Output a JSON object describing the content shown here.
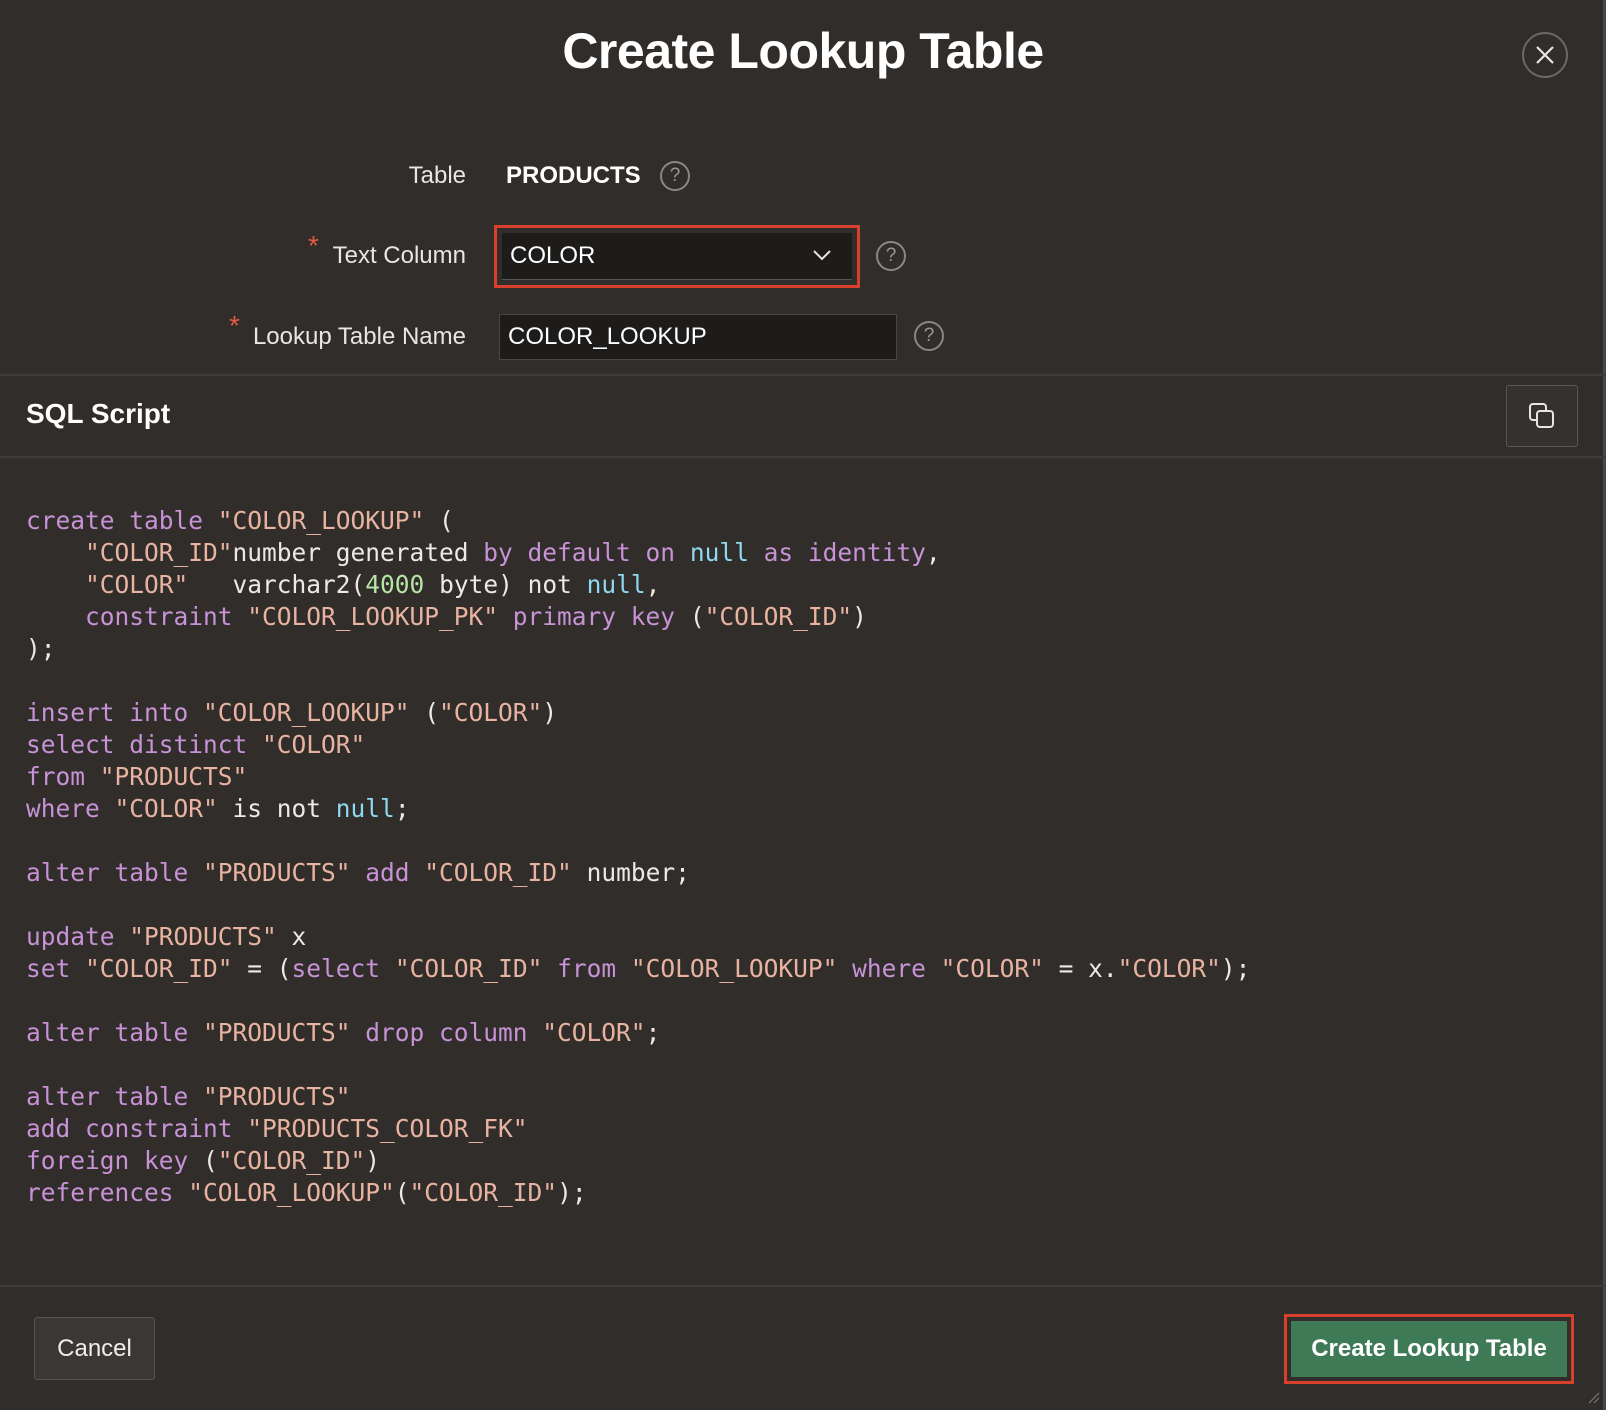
{
  "dialog": {
    "title": "Create Lookup Table",
    "close_icon": "close-icon"
  },
  "form": {
    "table_label": "Table",
    "table_value": "PRODUCTS",
    "text_column_label": "Text Column",
    "text_column_value": "COLOR",
    "lookup_table_name_label": "Lookup Table Name",
    "lookup_table_name_value": "COLOR_LOOKUP",
    "required_marker": "*",
    "help_glyph": "?"
  },
  "sql_section": {
    "title": "SQL Script",
    "copy_icon": "copy-icon",
    "lines": [
      [
        [
          "kw",
          "create table "
        ],
        [
          "str",
          "\"COLOR_LOOKUP\""
        ],
        [
          "plain",
          " ("
        ]
      ],
      [
        [
          "plain",
          "    "
        ],
        [
          "str",
          "\"COLOR_ID\""
        ],
        [
          "plain",
          "number generated "
        ],
        [
          "kw",
          "by default on "
        ],
        [
          "lit",
          "null"
        ],
        [
          "kw",
          " as "
        ],
        [
          "kw",
          "identity"
        ],
        [
          "plain",
          ","
        ]
      ],
      [
        [
          "plain",
          "    "
        ],
        [
          "str",
          "\"COLOR\""
        ],
        [
          "plain",
          "   varchar2("
        ],
        [
          "num",
          "4000"
        ],
        [
          "plain",
          " byte) not "
        ],
        [
          "lit",
          "null"
        ],
        [
          "plain",
          ","
        ]
      ],
      [
        [
          "plain",
          "    "
        ],
        [
          "kw",
          "constraint "
        ],
        [
          "str",
          "\"COLOR_LOOKUP_PK\""
        ],
        [
          "kw",
          " primary key "
        ],
        [
          "plain",
          "("
        ],
        [
          "str",
          "\"COLOR_ID\""
        ],
        [
          "plain",
          ")"
        ]
      ],
      [
        [
          "plain",
          ");"
        ]
      ],
      [
        [
          "plain",
          ""
        ]
      ],
      [
        [
          "kw",
          "insert into "
        ],
        [
          "str",
          "\"COLOR_LOOKUP\""
        ],
        [
          "plain",
          " ("
        ],
        [
          "str",
          "\"COLOR\""
        ],
        [
          "plain",
          ")"
        ]
      ],
      [
        [
          "kw",
          "select distinct "
        ],
        [
          "str",
          "\"COLOR\""
        ]
      ],
      [
        [
          "kw",
          "from "
        ],
        [
          "str",
          "\"PRODUCTS\""
        ]
      ],
      [
        [
          "kw",
          "where "
        ],
        [
          "str",
          "\"COLOR\""
        ],
        [
          "plain",
          " is not "
        ],
        [
          "lit",
          "null"
        ],
        [
          "plain",
          ";"
        ]
      ],
      [
        [
          "plain",
          ""
        ]
      ],
      [
        [
          "kw",
          "alter table "
        ],
        [
          "str",
          "\"PRODUCTS\""
        ],
        [
          "kw",
          " add "
        ],
        [
          "str",
          "\"COLOR_ID\""
        ],
        [
          "plain",
          " number;"
        ]
      ],
      [
        [
          "plain",
          ""
        ]
      ],
      [
        [
          "kw",
          "update "
        ],
        [
          "str",
          "\"PRODUCTS\""
        ],
        [
          "plain",
          " x"
        ]
      ],
      [
        [
          "kw",
          "set "
        ],
        [
          "str",
          "\"COLOR_ID\""
        ],
        [
          "plain",
          " = ("
        ],
        [
          "kw",
          "select "
        ],
        [
          "str",
          "\"COLOR_ID\""
        ],
        [
          "kw",
          " from "
        ],
        [
          "str",
          "\"COLOR_LOOKUP\""
        ],
        [
          "kw",
          " where "
        ],
        [
          "str",
          "\"COLOR\""
        ],
        [
          "plain",
          " = x."
        ],
        [
          "str",
          "\"COLOR\""
        ],
        [
          "plain",
          ");"
        ]
      ],
      [
        [
          "plain",
          ""
        ]
      ],
      [
        [
          "kw",
          "alter table "
        ],
        [
          "str",
          "\"PRODUCTS\""
        ],
        [
          "kw",
          " drop column "
        ],
        [
          "str",
          "\"COLOR\""
        ],
        [
          "plain",
          ";"
        ]
      ],
      [
        [
          "plain",
          ""
        ]
      ],
      [
        [
          "kw",
          "alter table "
        ],
        [
          "str",
          "\"PRODUCTS\""
        ]
      ],
      [
        [
          "kw",
          "add constraint "
        ],
        [
          "str",
          "\"PRODUCTS_COLOR_FK\""
        ]
      ],
      [
        [
          "kw",
          "foreign key "
        ],
        [
          "plain",
          "("
        ],
        [
          "str",
          "\"COLOR_ID\""
        ],
        [
          "plain",
          ")"
        ]
      ],
      [
        [
          "kw",
          "references "
        ],
        [
          "str",
          "\"COLOR_LOOKUP\""
        ],
        [
          "plain",
          "("
        ],
        [
          "str",
          "\"COLOR_ID\""
        ],
        [
          "plain",
          ");"
        ]
      ]
    ]
  },
  "footer": {
    "cancel_label": "Cancel",
    "create_label": "Create Lookup Table"
  },
  "colors": {
    "background": "#312d2a",
    "keyword": "#c792d6",
    "string": "#e8b3a0",
    "null_literal": "#8ed8f0",
    "number": "#b6e3a6",
    "primary_button": "#3f7a56",
    "highlight_border": "#d9402b"
  }
}
